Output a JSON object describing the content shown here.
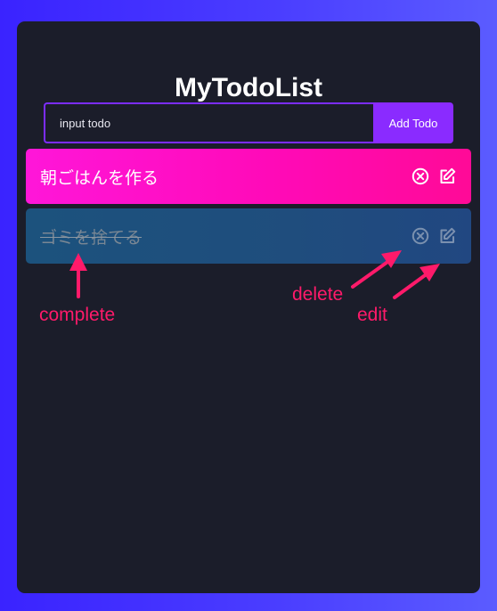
{
  "app": {
    "title": "MyTodoList"
  },
  "form": {
    "input_value": "",
    "input_placeholder": "input todo",
    "add_button_label": "Add Todo"
  },
  "todos": [
    {
      "text": "朝ごはんを作る",
      "completed": false
    },
    {
      "text": "ゴミを捨てる",
      "completed": true
    }
  ],
  "icons": {
    "delete": "circle-x-icon",
    "edit": "pencil-square-icon"
  },
  "annotations": {
    "complete_label": "complete",
    "delete_label": "delete",
    "edit_label": "edit"
  },
  "colors": {
    "background_from": "#3a23ff",
    "background_to": "#5b5cff",
    "panel": "#1b1d2a",
    "accent": "#8a2bff",
    "active_todo": "#ff0ab8",
    "completed_todo": "#1f4d7d",
    "annotation": "#ff1a6a"
  }
}
